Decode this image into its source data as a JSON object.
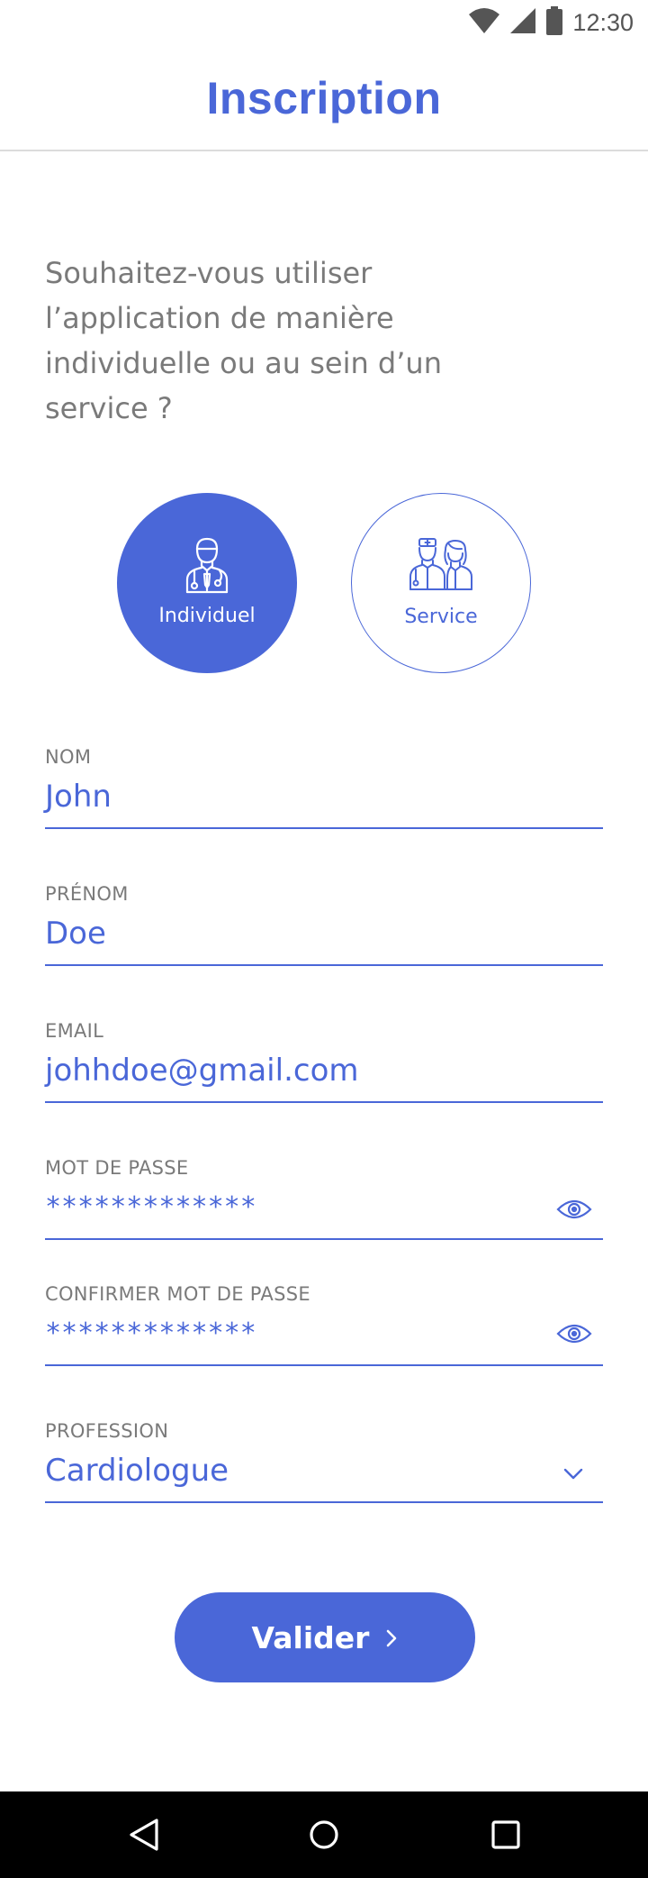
{
  "status_bar": {
    "time": "12:30",
    "icons": [
      "wifi-icon",
      "signal-icon",
      "battery-icon"
    ]
  },
  "header": {
    "title": "Inscription"
  },
  "question": "Souhaitez-vous utiliser l’application de manière individuelle ou au sein d’un service ?",
  "modes": [
    {
      "label": "Individuel",
      "icon": "doctor-icon",
      "selected": true
    },
    {
      "label": "Service",
      "icon": "medical-team-icon",
      "selected": false
    }
  ],
  "form": {
    "nom": {
      "label": "NOM",
      "value": "John"
    },
    "prenom": {
      "label": "PRÉNOM",
      "value": "Doe"
    },
    "email": {
      "label": "EMAIL",
      "value": "johhdoe@gmail.com"
    },
    "password": {
      "label": "MOT DE PASSE",
      "value": "*************"
    },
    "confirm_password": {
      "label": "CONFIRMER MOT DE PASSE",
      "value": "*************"
    },
    "profession": {
      "label": "PROFESSION",
      "value": "Cardiologue"
    }
  },
  "submit": {
    "label": "Valider"
  },
  "nav": [
    "back-icon",
    "home-icon",
    "recents-icon"
  ],
  "colors": {
    "accent": "#4a67d8",
    "label_gray": "#7a7a7a",
    "nav_bg": "#000000"
  }
}
